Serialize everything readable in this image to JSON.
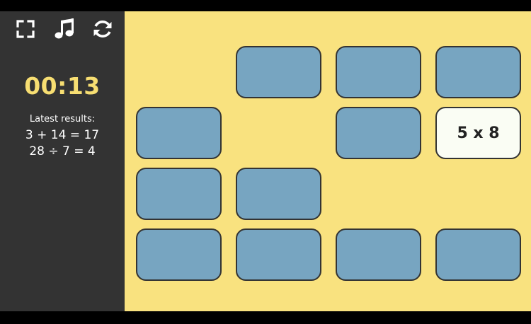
{
  "toolbar": {
    "buttons": [
      {
        "name": "fullscreen-icon"
      },
      {
        "name": "music-note-icon"
      },
      {
        "name": "restart-icon"
      }
    ]
  },
  "timer": "00:13",
  "results": {
    "title": "Latest results:",
    "lines": [
      "3 + 14 = 17",
      "28 ÷ 7 = 4"
    ]
  },
  "board": {
    "rows": [
      [
        null,
        "hidden",
        "hidden",
        "hidden"
      ],
      [
        "hidden",
        null,
        "hidden",
        "5 x 8"
      ],
      [
        "hidden",
        "hidden",
        null,
        null
      ],
      [
        "hidden",
        "hidden",
        "hidden",
        "hidden"
      ]
    ]
  },
  "colors": {
    "sidebar": "#333333",
    "board": "#f9e27f",
    "card_back": "#77a5c1",
    "card_face": "#fafdf4",
    "timer": "#f7de72"
  }
}
